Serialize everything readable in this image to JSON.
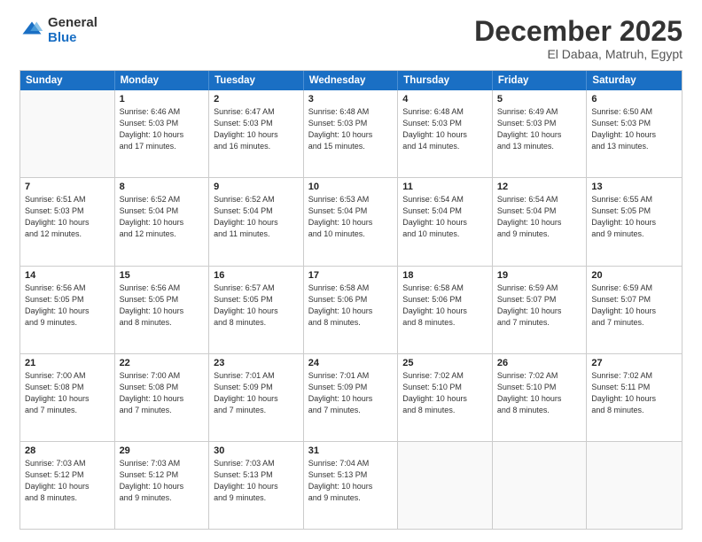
{
  "logo": {
    "general": "General",
    "blue": "Blue"
  },
  "title": {
    "month": "December 2025",
    "location": "El Dabaa, Matruh, Egypt"
  },
  "header_days": [
    "Sunday",
    "Monday",
    "Tuesday",
    "Wednesday",
    "Thursday",
    "Friday",
    "Saturday"
  ],
  "weeks": [
    [
      {
        "day": "",
        "lines": []
      },
      {
        "day": "1",
        "lines": [
          "Sunrise: 6:46 AM",
          "Sunset: 5:03 PM",
          "Daylight: 10 hours",
          "and 17 minutes."
        ]
      },
      {
        "day": "2",
        "lines": [
          "Sunrise: 6:47 AM",
          "Sunset: 5:03 PM",
          "Daylight: 10 hours",
          "and 16 minutes."
        ]
      },
      {
        "day": "3",
        "lines": [
          "Sunrise: 6:48 AM",
          "Sunset: 5:03 PM",
          "Daylight: 10 hours",
          "and 15 minutes."
        ]
      },
      {
        "day": "4",
        "lines": [
          "Sunrise: 6:48 AM",
          "Sunset: 5:03 PM",
          "Daylight: 10 hours",
          "and 14 minutes."
        ]
      },
      {
        "day": "5",
        "lines": [
          "Sunrise: 6:49 AM",
          "Sunset: 5:03 PM",
          "Daylight: 10 hours",
          "and 13 minutes."
        ]
      },
      {
        "day": "6",
        "lines": [
          "Sunrise: 6:50 AM",
          "Sunset: 5:03 PM",
          "Daylight: 10 hours",
          "and 13 minutes."
        ]
      }
    ],
    [
      {
        "day": "7",
        "lines": [
          "Sunrise: 6:51 AM",
          "Sunset: 5:03 PM",
          "Daylight: 10 hours",
          "and 12 minutes."
        ]
      },
      {
        "day": "8",
        "lines": [
          "Sunrise: 6:52 AM",
          "Sunset: 5:04 PM",
          "Daylight: 10 hours",
          "and 12 minutes."
        ]
      },
      {
        "day": "9",
        "lines": [
          "Sunrise: 6:52 AM",
          "Sunset: 5:04 PM",
          "Daylight: 10 hours",
          "and 11 minutes."
        ]
      },
      {
        "day": "10",
        "lines": [
          "Sunrise: 6:53 AM",
          "Sunset: 5:04 PM",
          "Daylight: 10 hours",
          "and 10 minutes."
        ]
      },
      {
        "day": "11",
        "lines": [
          "Sunrise: 6:54 AM",
          "Sunset: 5:04 PM",
          "Daylight: 10 hours",
          "and 10 minutes."
        ]
      },
      {
        "day": "12",
        "lines": [
          "Sunrise: 6:54 AM",
          "Sunset: 5:04 PM",
          "Daylight: 10 hours",
          "and 9 minutes."
        ]
      },
      {
        "day": "13",
        "lines": [
          "Sunrise: 6:55 AM",
          "Sunset: 5:05 PM",
          "Daylight: 10 hours",
          "and 9 minutes."
        ]
      }
    ],
    [
      {
        "day": "14",
        "lines": [
          "Sunrise: 6:56 AM",
          "Sunset: 5:05 PM",
          "Daylight: 10 hours",
          "and 9 minutes."
        ]
      },
      {
        "day": "15",
        "lines": [
          "Sunrise: 6:56 AM",
          "Sunset: 5:05 PM",
          "Daylight: 10 hours",
          "and 8 minutes."
        ]
      },
      {
        "day": "16",
        "lines": [
          "Sunrise: 6:57 AM",
          "Sunset: 5:05 PM",
          "Daylight: 10 hours",
          "and 8 minutes."
        ]
      },
      {
        "day": "17",
        "lines": [
          "Sunrise: 6:58 AM",
          "Sunset: 5:06 PM",
          "Daylight: 10 hours",
          "and 8 minutes."
        ]
      },
      {
        "day": "18",
        "lines": [
          "Sunrise: 6:58 AM",
          "Sunset: 5:06 PM",
          "Daylight: 10 hours",
          "and 8 minutes."
        ]
      },
      {
        "day": "19",
        "lines": [
          "Sunrise: 6:59 AM",
          "Sunset: 5:07 PM",
          "Daylight: 10 hours",
          "and 7 minutes."
        ]
      },
      {
        "day": "20",
        "lines": [
          "Sunrise: 6:59 AM",
          "Sunset: 5:07 PM",
          "Daylight: 10 hours",
          "and 7 minutes."
        ]
      }
    ],
    [
      {
        "day": "21",
        "lines": [
          "Sunrise: 7:00 AM",
          "Sunset: 5:08 PM",
          "Daylight: 10 hours",
          "and 7 minutes."
        ]
      },
      {
        "day": "22",
        "lines": [
          "Sunrise: 7:00 AM",
          "Sunset: 5:08 PM",
          "Daylight: 10 hours",
          "and 7 minutes."
        ]
      },
      {
        "day": "23",
        "lines": [
          "Sunrise: 7:01 AM",
          "Sunset: 5:09 PM",
          "Daylight: 10 hours",
          "and 7 minutes."
        ]
      },
      {
        "day": "24",
        "lines": [
          "Sunrise: 7:01 AM",
          "Sunset: 5:09 PM",
          "Daylight: 10 hours",
          "and 7 minutes."
        ]
      },
      {
        "day": "25",
        "lines": [
          "Sunrise: 7:02 AM",
          "Sunset: 5:10 PM",
          "Daylight: 10 hours",
          "and 8 minutes."
        ]
      },
      {
        "day": "26",
        "lines": [
          "Sunrise: 7:02 AM",
          "Sunset: 5:10 PM",
          "Daylight: 10 hours",
          "and 8 minutes."
        ]
      },
      {
        "day": "27",
        "lines": [
          "Sunrise: 7:02 AM",
          "Sunset: 5:11 PM",
          "Daylight: 10 hours",
          "and 8 minutes."
        ]
      }
    ],
    [
      {
        "day": "28",
        "lines": [
          "Sunrise: 7:03 AM",
          "Sunset: 5:12 PM",
          "Daylight: 10 hours",
          "and 8 minutes."
        ]
      },
      {
        "day": "29",
        "lines": [
          "Sunrise: 7:03 AM",
          "Sunset: 5:12 PM",
          "Daylight: 10 hours",
          "and 9 minutes."
        ]
      },
      {
        "day": "30",
        "lines": [
          "Sunrise: 7:03 AM",
          "Sunset: 5:13 PM",
          "Daylight: 10 hours",
          "and 9 minutes."
        ]
      },
      {
        "day": "31",
        "lines": [
          "Sunrise: 7:04 AM",
          "Sunset: 5:13 PM",
          "Daylight: 10 hours",
          "and 9 minutes."
        ]
      },
      {
        "day": "",
        "lines": []
      },
      {
        "day": "",
        "lines": []
      },
      {
        "day": "",
        "lines": []
      }
    ]
  ]
}
